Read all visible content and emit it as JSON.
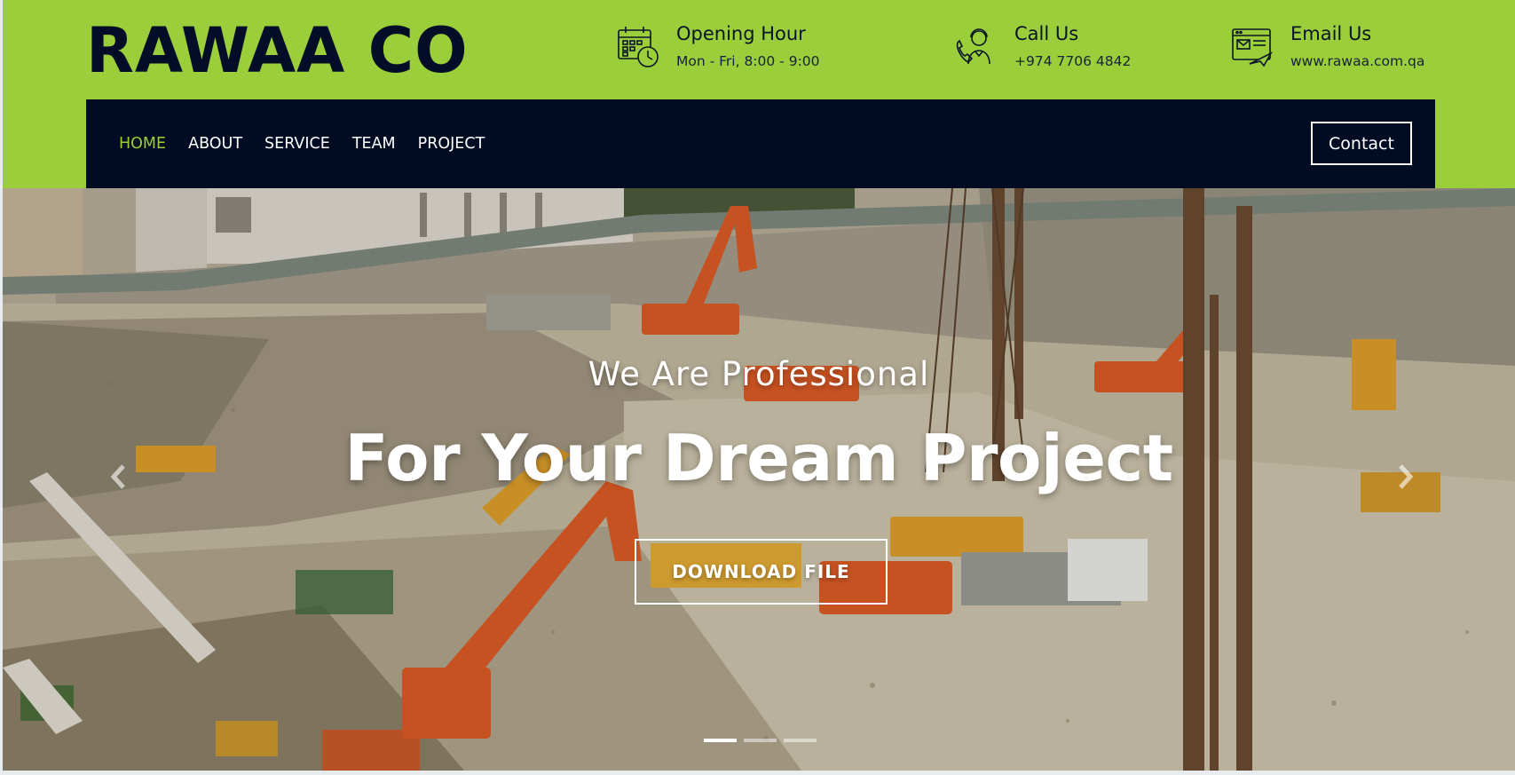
{
  "brand": {
    "logo_text": "RAWAA CO"
  },
  "header_info": [
    {
      "icon": "calendar-clock-icon",
      "title": "Opening Hour",
      "detail": "Mon - Fri, 8:00 - 9:00"
    },
    {
      "icon": "support-agent-icon",
      "title": "Call Us",
      "detail": "+974 7706 4842"
    },
    {
      "icon": "email-browser-icon",
      "title": "Email Us",
      "detail": "www.rawaa.com.qa"
    }
  ],
  "nav": {
    "items": [
      {
        "label": "HOME",
        "active": true
      },
      {
        "label": "ABOUT",
        "active": false
      },
      {
        "label": "SERVICE",
        "active": false
      },
      {
        "label": "TEAM",
        "active": false
      },
      {
        "label": "PROJECT",
        "active": false
      }
    ],
    "contact_label": "Contact"
  },
  "hero": {
    "subtitle": "We Are Professional",
    "title": "For Your Dream Project",
    "button_label": "DOWNLOAD FILE",
    "background_image": "construction site with excavators, cranes and trucks",
    "prev_icon": "chevron-left-icon",
    "next_icon": "chevron-right-icon",
    "slides_total": 3,
    "active_slide": 1
  },
  "colors": {
    "accent": "#9ace3a",
    "navy": "#010b22",
    "logo": "#030d27",
    "white": "#ffffff"
  }
}
